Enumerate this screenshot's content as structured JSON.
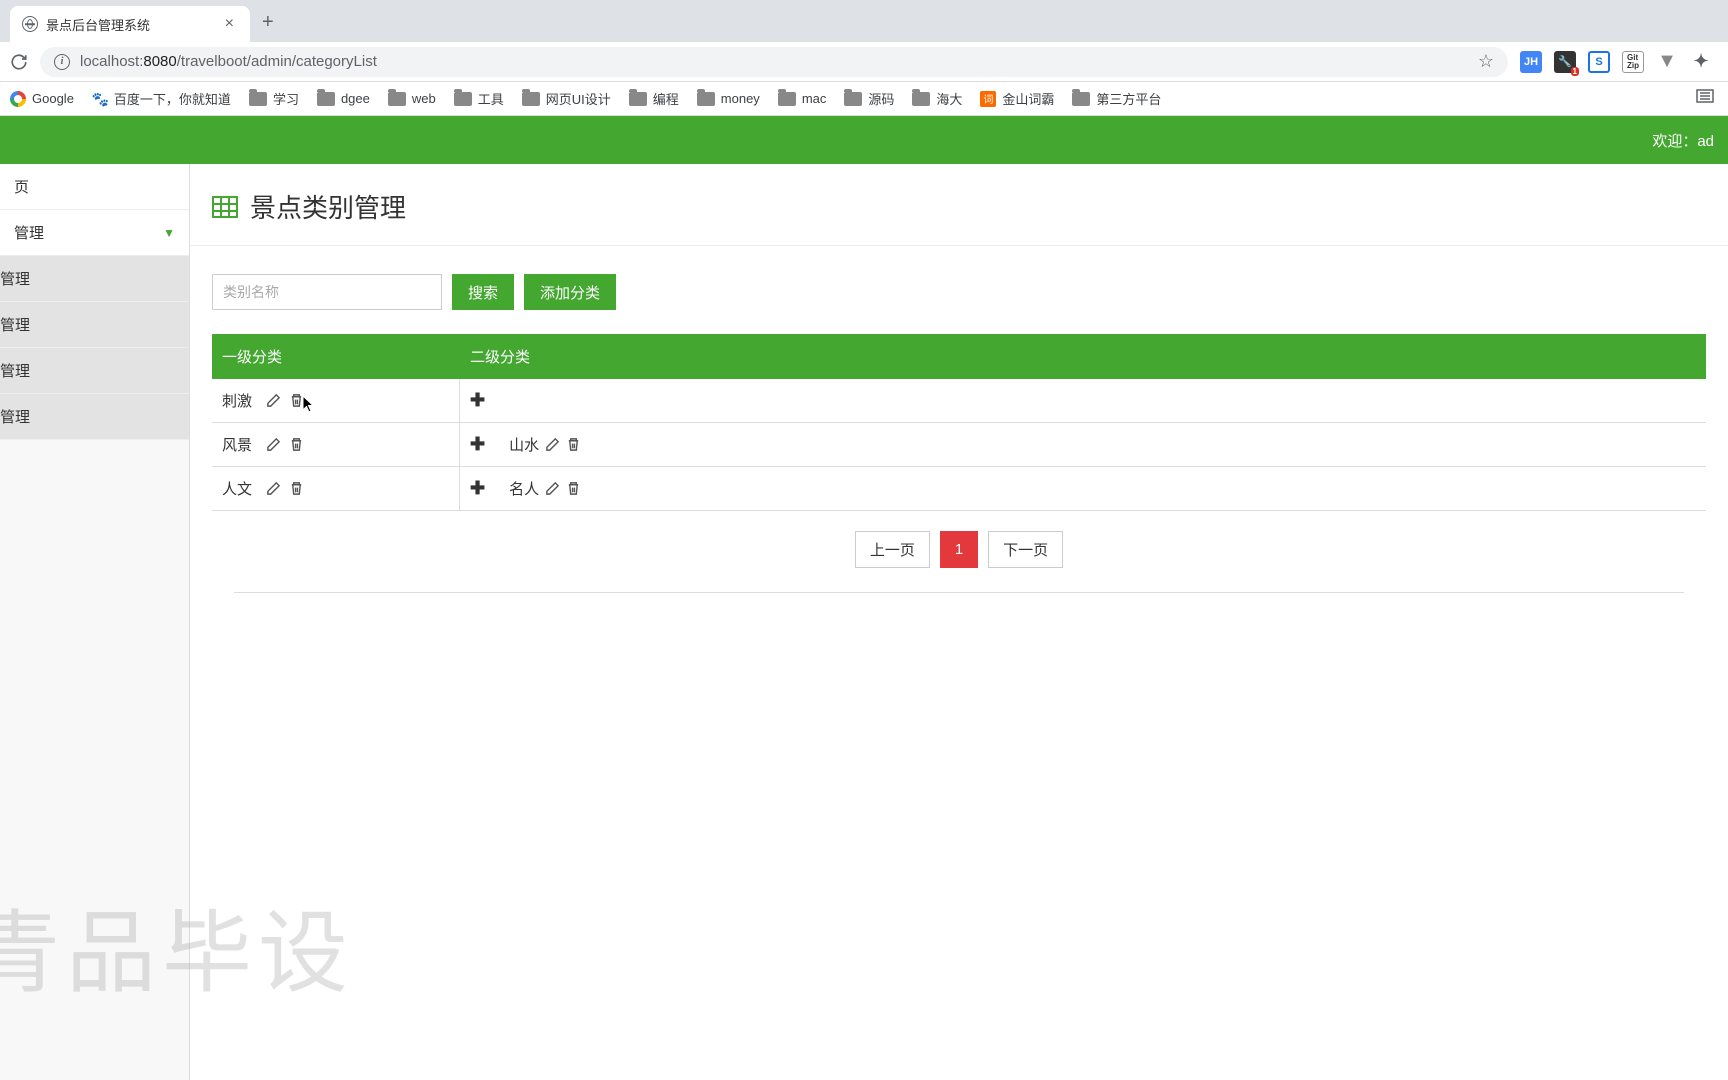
{
  "browser": {
    "tab_title": "景点后台管理系统",
    "url_host": "localhost:",
    "url_port": "8080",
    "url_path": "/travelboot/admin/categoryList",
    "bookmarks": [
      {
        "label": "Google",
        "icon": "google"
      },
      {
        "label": "百度一下，你就知道",
        "icon": "baidu"
      },
      {
        "label": "学习",
        "icon": "folder"
      },
      {
        "label": "dgee",
        "icon": "folder"
      },
      {
        "label": "web",
        "icon": "folder"
      },
      {
        "label": "工具",
        "icon": "folder"
      },
      {
        "label": "网页UI设计",
        "icon": "folder"
      },
      {
        "label": "编程",
        "icon": "folder"
      },
      {
        "label": "money",
        "icon": "folder"
      },
      {
        "label": "mac",
        "icon": "folder"
      },
      {
        "label": "源码",
        "icon": "folder"
      },
      {
        "label": "海大",
        "icon": "folder"
      },
      {
        "label": "金山词霸",
        "icon": "jinshan"
      },
      {
        "label": "第三方平台",
        "icon": "folder"
      }
    ],
    "extensions": [
      "JH",
      "dev",
      "S",
      "GitZip",
      "V",
      "puzzle"
    ]
  },
  "header": {
    "welcome": "欢迎：ad"
  },
  "sidebar": {
    "items": [
      {
        "label": "页",
        "type": "top"
      },
      {
        "label": "管理",
        "type": "parent"
      },
      {
        "label": "管理",
        "type": "child"
      },
      {
        "label": "管理",
        "type": "child"
      },
      {
        "label": "管理",
        "type": "child"
      },
      {
        "label": "管理",
        "type": "child"
      }
    ]
  },
  "page": {
    "title": "景点类别管理",
    "search_placeholder": "类别名称",
    "btn_search": "搜索",
    "btn_add": "添加分类"
  },
  "table": {
    "col1": "一级分类",
    "col2": "二级分类",
    "rows": [
      {
        "level1": "刺激",
        "level2": []
      },
      {
        "level1": "风景",
        "level2": [
          {
            "name": "山水"
          }
        ]
      },
      {
        "level1": "人文",
        "level2": [
          {
            "name": "名人"
          }
        ]
      }
    ]
  },
  "pagination": {
    "prev": "上一页",
    "current": "1",
    "next": "下一页"
  },
  "watermark": "青品毕设",
  "colors": {
    "primary": "#43a730",
    "danger": "#e4393c"
  }
}
